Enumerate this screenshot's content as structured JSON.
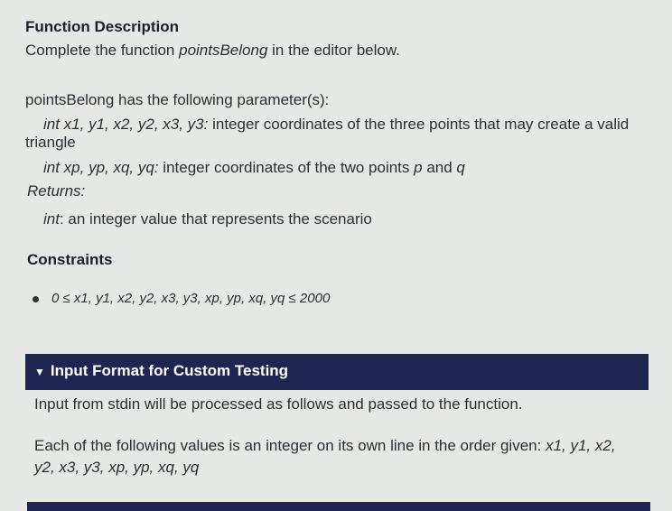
{
  "function_description": {
    "heading": "Function Description",
    "intro_prefix": "Complete the function ",
    "function_name": "pointsBelong",
    "intro_suffix": " in the editor below."
  },
  "parameters": {
    "heading": "pointsBelong has the following parameter(s):",
    "param1_type": "int x1, y1, x2, y2, x3, y3:",
    "param1_desc": " integer coordinates of the three points that may create a valid",
    "param1_desc_cont": "triangle",
    "param2_type": "int xp, yp, xq, yq:",
    "param2_desc": " integer coordinates of the two points ",
    "param2_p": "p",
    "param2_and": " and ",
    "param2_q": "q",
    "returns_label": "Returns:",
    "returns_type": "int",
    "returns_desc": ": an integer value that represents the scenario"
  },
  "constraints": {
    "heading": "Constraints",
    "items": [
      "0 ≤ x1, y1, x2, y2, x3, y3, xp, yp, xq, yq ≤ 2000"
    ]
  },
  "input_format": {
    "header": "Input Format for Custom Testing",
    "line1": "Input from stdin will be processed as follows and passed to the function.",
    "line2": "Each of the following values is an integer on its own line in the order given: ",
    "line2_vars1": "x1, y1, x2,",
    "line2_vars2": "y2, x3, y3, xp, yp, xq, yq"
  }
}
